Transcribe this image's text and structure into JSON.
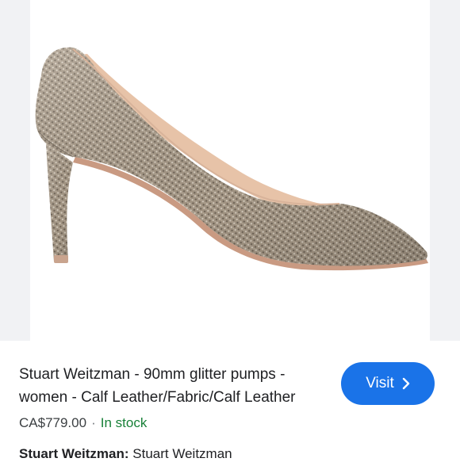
{
  "product": {
    "title": "Stuart Weitzman - 90mm glitter pumps - women - Calf Leather/Fabric/Calf Leather",
    "price": "CA$779.00",
    "separator": "·",
    "stock": "In stock",
    "brand_key": "Stuart Weitzman:",
    "brand_value": "Stuart Weitzman"
  },
  "actions": {
    "visit_label": "Visit",
    "visit_icon": "chevron-right-icon"
  },
  "colors": {
    "accent": "#1a73e8",
    "in_stock": "#188038",
    "text_primary": "#202124",
    "text_secondary": "#3c4043",
    "image_side_panel": "#f1f2f4"
  }
}
